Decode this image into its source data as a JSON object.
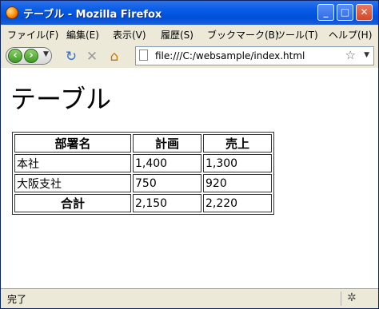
{
  "window": {
    "title": "テーブル - Mozilla Firefox"
  },
  "window_buttons": {
    "minimize": "_",
    "maximize": "□",
    "close": "✕"
  },
  "menu": [
    "ファイル(F)",
    "編集(E)",
    "表示(V)",
    "履歴(S)",
    "ブックマーク(B)",
    "ツール(T)",
    "ヘルプ(H)"
  ],
  "toolbar": {
    "url": "file:///C:/websample/index.html"
  },
  "page": {
    "heading": "テーブル",
    "table": {
      "headers": [
        "部署名",
        "計画",
        "売上"
      ],
      "rows": [
        [
          "本社",
          "1,400",
          "1,300"
        ],
        [
          "大阪支社",
          "750",
          "920"
        ]
      ],
      "total": [
        "合計",
        "2,150",
        "2,220"
      ]
    }
  },
  "status": {
    "text": "完了"
  }
}
